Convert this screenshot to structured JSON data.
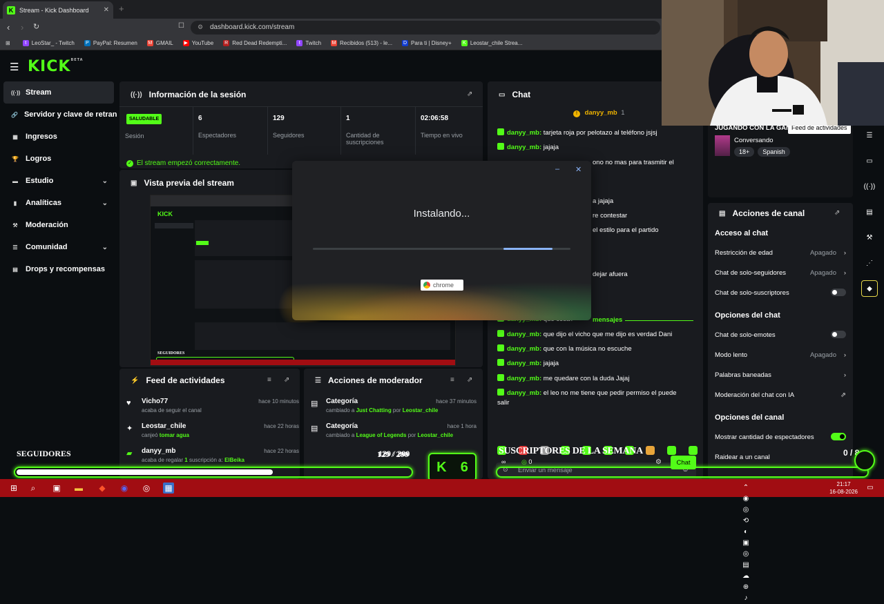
{
  "browser": {
    "tab_title": "Stream - Kick Dashboard",
    "url": "dashboard.kick.com/stream",
    "bookmarks": [
      {
        "label": "LeoStar_ - Twitch",
        "color": "#9146ff",
        "glyph": "t"
      },
      {
        "label": "PayPal: Resumen",
        "color": "#0070ba",
        "glyph": "P"
      },
      {
        "label": "GMAIL",
        "color": "#ea4335",
        "glyph": "M"
      },
      {
        "label": "YouTube",
        "color": "#ff0000",
        "glyph": "▶"
      },
      {
        "label": "Red Dead Redempti...",
        "color": "#b41e1e",
        "glyph": "R"
      },
      {
        "label": "Twitch",
        "color": "#9146ff",
        "glyph": "t"
      },
      {
        "label": "Recibidos (513) - le...",
        "color": "#ea4335",
        "glyph": "M"
      },
      {
        "label": "Para ti | Disney+",
        "color": "#113ccf",
        "glyph": "D"
      },
      {
        "label": "Leostar_chile Strea...",
        "color": "#53fc18",
        "glyph": "K"
      }
    ]
  },
  "nav": {
    "logo": "KICK",
    "logo_sup": "BETA"
  },
  "sidebar": {
    "items": [
      {
        "label": "Stream",
        "icon": "broadcast-icon",
        "glyph": "((·))",
        "active": true,
        "chevron": false
      },
      {
        "label": "Servidor y clave de retransmisión",
        "icon": "link-icon",
        "glyph": "🔗",
        "active": false,
        "chevron": false
      },
      {
        "label": "Ingresos",
        "icon": "bank-icon",
        "glyph": "▦",
        "active": false,
        "chevron": false
      },
      {
        "label": "Logros",
        "icon": "trophy-icon",
        "glyph": "🏆",
        "active": false,
        "chevron": false
      },
      {
        "label": "Estudio",
        "icon": "studio-icon",
        "glyph": "▬",
        "active": false,
        "chevron": true
      },
      {
        "label": "Analíticas",
        "icon": "chart-icon",
        "glyph": "▮",
        "active": false,
        "chevron": true
      },
      {
        "label": "Moderación",
        "icon": "hammer-icon",
        "glyph": "⚒",
        "active": false,
        "chevron": false
      },
      {
        "label": "Comunidad",
        "icon": "community-icon",
        "glyph": "☰",
        "active": false,
        "chevron": true
      },
      {
        "label": "Drops y recompensas",
        "icon": "gift-icon",
        "glyph": "▤",
        "active": false,
        "chevron": false
      }
    ]
  },
  "session": {
    "title": "Información de la sesión",
    "status_badge": "SALUDABLE",
    "status_label": "Sesión",
    "stats": [
      {
        "value": "6",
        "label": "Espectadores"
      },
      {
        "value": "129",
        "label": "Seguidores"
      },
      {
        "value": "1",
        "label": "Cantidad de suscripciones"
      },
      {
        "value": "02:06:58",
        "label": "Tiempo en vivo"
      }
    ],
    "ok_message": "El stream empezó correctamente."
  },
  "preview": {
    "title": "Vista previa del stream"
  },
  "activity_feed": {
    "title": "Feed de actividades",
    "items": [
      {
        "name": "Vicho77",
        "time": "hace 10 minutos",
        "pre": "acaba de seguir el canal",
        "hl": "",
        "post": "",
        "icon": "heart-icon",
        "glyph": "♥"
      },
      {
        "name": "Leostar_chile",
        "time": "hace 22 horas",
        "pre": "canjeó ",
        "hl": "tomar agua",
        "post": "",
        "icon": "reward-icon",
        "glyph": "✦"
      },
      {
        "name": "danyy_mb",
        "time": "hace 22 horas",
        "pre": "acaba de regalar ",
        "hl": "1",
        "post": " suscripción a: ",
        "hl2": "ElBeika",
        "icon": "gift-sub-icon",
        "glyph": "▰"
      }
    ]
  },
  "mod_actions": {
    "title": "Acciones de moderador",
    "items": [
      {
        "name": "Categoría",
        "time": "hace 37 minutos",
        "pre": "cambiado a ",
        "hl": "Just Chatting",
        "mid": " por ",
        "hl2": "Leostar_chile"
      },
      {
        "name": "Categoría",
        "time": "hace 1 hora",
        "pre": "cambiado a ",
        "hl": "League of Legends",
        "mid": " por ",
        "hl2": "Leostar_chile"
      }
    ]
  },
  "chat": {
    "title": "Chat",
    "pinned_user": "danyy_mb",
    "pinned_count": "1",
    "messages": [
      {
        "user": "danyy_mb:",
        "text": "tarjeta roja por pelotazo al teléfono jsjsj"
      },
      {
        "user": "danyy_mb:",
        "text": "jajaja"
      },
      {
        "user": "",
        "text": "ono no mas para trasmitir el"
      },
      {
        "user": "",
        "text": "a jajaja"
      },
      {
        "user": "",
        "text": "re contestar"
      },
      {
        "user": "",
        "text": "el estilo para el partido"
      },
      {
        "user": "",
        "text": "dejar afuera"
      },
      {
        "user": "danyy_mb:",
        "text": "que cosa?"
      },
      {
        "user": "danyy_mb:",
        "text": "que dijo el vicho que me dijo es verdad Dani"
      },
      {
        "user": "danyy_mb:",
        "text": "que con la música no escuche"
      },
      {
        "user": "danyy_mb:",
        "text": "jajaja"
      },
      {
        "user": "danyy_mb:",
        "text": "me quedare con la duda Jajaj"
      },
      {
        "user": "danyy_mb:",
        "text": "el leo no me tiene que pedir permiso el puede"
      },
      {
        "user": "",
        "text": "salir"
      }
    ],
    "new_messages_label": "mensajes",
    "input_placeholder": "Enviar un mensaje",
    "send_label": "Chat",
    "counter": "0"
  },
  "stream_info": {
    "title": "JUGANDO CON LA GANGA",
    "category": "Conversando",
    "tags": [
      "18+",
      "Spanish"
    ]
  },
  "channel_actions": {
    "title": "Acciones de canal",
    "sections": [
      {
        "heading": "Acceso al chat",
        "rows": [
          {
            "label": "Restricción de edad",
            "value": "Apagado",
            "type": "arrow"
          },
          {
            "label": "Chat de solo-seguidores",
            "value": "Apagado",
            "type": "arrow"
          },
          {
            "label": "Chat de solo-suscriptores",
            "value": "",
            "type": "toggle-off"
          }
        ]
      },
      {
        "heading": "Opciones del chat",
        "rows": [
          {
            "label": "Chat de solo-emotes",
            "value": "",
            "type": "toggle-off"
          },
          {
            "label": "Modo lento",
            "value": "Apagado",
            "type": "arrow"
          },
          {
            "label": "Palabras baneadas",
            "value": "",
            "type": "arrow"
          },
          {
            "label": "Moderación del chat con IA",
            "value": "",
            "type": "external"
          }
        ]
      },
      {
        "heading": "Opciones del canal",
        "rows": [
          {
            "label": "Mostrar cantidad de espectadores",
            "value": "",
            "type": "toggle-on"
          },
          {
            "label": "Raidear a un canal",
            "value": "",
            "type": "none"
          }
        ]
      }
    ]
  },
  "rail": {
    "tooltip": "Feed de actividades",
    "buttons": [
      {
        "name": "rail-preview-icon",
        "glyph": "▣"
      },
      {
        "name": "rail-activity-icon",
        "glyph": "⚡"
      },
      {
        "name": "rail-list-icon",
        "glyph": "☰"
      },
      {
        "name": "rail-chat-icon",
        "glyph": "▭"
      },
      {
        "name": "rail-broadcast-icon",
        "glyph": "((·))"
      },
      {
        "name": "rail-session-icon",
        "glyph": "▤"
      },
      {
        "name": "rail-mod-icon",
        "glyph": "⚒"
      },
      {
        "name": "rail-share-icon",
        "glyph": "⋰"
      },
      {
        "name": "rail-tag-icon",
        "glyph": "◆"
      }
    ]
  },
  "installer": {
    "status": "Instalando...",
    "brand": "chrome",
    "progress_start": 0.74,
    "progress_end": 0.93
  },
  "overlay": {
    "seguidores_label": "SEGUIDORES",
    "followers_count": "129 / 200",
    "followers_progress": 0.65,
    "subs_label": "SUSCRIPTORES DE LA SEMANA",
    "subs_count": "0 / 8",
    "k_badge_letter": "K",
    "k_badge_value": "6"
  },
  "taskbar": {
    "time": "21:17",
    "date": "16-08-2026"
  }
}
